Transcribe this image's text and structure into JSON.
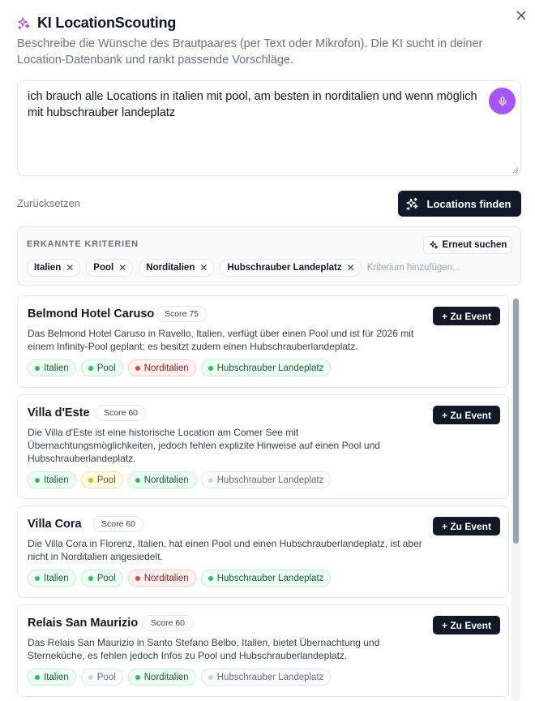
{
  "header": {
    "title": "KI LocationScouting",
    "subtitle": "Beschreibe die Wünsche des Brautpaares (per Text oder Mikrofon). Die KI sucht in deiner Location-Datenbank und rankt passende Vorschläge.",
    "close_icon": "close-icon",
    "accent_color": "#a855f7"
  },
  "prompt": {
    "value": "ich brauch alle Locations in italien mit pool, am besten in norditalien und wenn möglich mit hubschrauber landeplatz",
    "mic_icon": "microphone-icon"
  },
  "actions": {
    "reset_label": "Zurücksetzen",
    "find_label": "Locations finden"
  },
  "criteria": {
    "title": "ERKANNTE KRITERIEN",
    "retry_label": "Erneut suchen",
    "chips": [
      {
        "label": "Italien"
      },
      {
        "label": "Pool"
      },
      {
        "label": "Norditalien"
      },
      {
        "label": "Hubschrauber Landeplatz"
      }
    ],
    "add_placeholder": "Kriterium hinzufügen..."
  },
  "results": [
    {
      "name": "Belmond Hotel Caruso",
      "score": "Score 75",
      "description": "Das Belmond Hotel Caruso in Ravello, Italien, verfügt über einen Pool und ist für 2026 mit einem Infinity-Pool geplant; es besitzt zudem einen Hubschrauberlandeplatz.",
      "add_label": "+ Zu Event",
      "tags": [
        {
          "label": "Italien",
          "status": "green"
        },
        {
          "label": "Pool",
          "status": "green"
        },
        {
          "label": "Norditalien",
          "status": "red"
        },
        {
          "label": "Hubschrauber Landeplatz",
          "status": "green"
        }
      ]
    },
    {
      "name": "Villa d'Este",
      "score": "Score 60",
      "description": "Die Villa d'Este ist eine historische Location am Comer See mit Übernachtungsmöglichkeiten, jedoch fehlen explizite Hinweise auf einen Pool und Hubschrauberlandeplatz.",
      "add_label": "+ Zu Event",
      "tags": [
        {
          "label": "Italien",
          "status": "green"
        },
        {
          "label": "Pool",
          "status": "yellow"
        },
        {
          "label": "Norditalien",
          "status": "green"
        },
        {
          "label": "Hubschrauber Landeplatz",
          "status": "gray"
        }
      ]
    },
    {
      "name": "Villa Cora",
      "score": "Score 60",
      "description": "Die Villa Cora in Florenz, Italien, hat einen Pool und einen Hubschrauberlandeplatz, ist aber nicht in Norditalien angesiedelt.",
      "add_label": "+ Zu Event",
      "tags": [
        {
          "label": "Italien",
          "status": "green"
        },
        {
          "label": "Pool",
          "status": "green"
        },
        {
          "label": "Norditalien",
          "status": "red"
        },
        {
          "label": "Hubschrauber Landeplatz",
          "status": "green"
        }
      ]
    },
    {
      "name": "Relais San Maurizio",
      "score": "Score 60",
      "description": "Das Relais San Maurizio in Santo Stefano Belbo, Italien, bietet Übernachtung und Sterneküche, es fehlen jedoch Infos zu Pool und Hubschrauberlandeplatz.",
      "add_label": "+ Zu Event",
      "tags": [
        {
          "label": "Italien",
          "status": "green"
        },
        {
          "label": "Pool",
          "status": "gray"
        },
        {
          "label": "Norditalien",
          "status": "green"
        },
        {
          "label": "Hubschrauber Landeplatz",
          "status": "gray"
        }
      ]
    }
  ]
}
